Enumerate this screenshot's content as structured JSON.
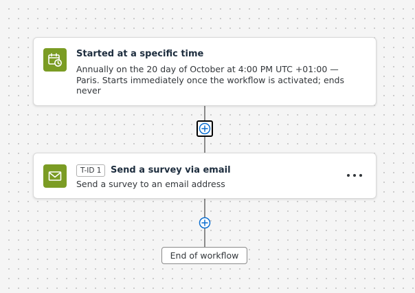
{
  "colors": {
    "accent": "#0a6ed1",
    "icon_tile": "#7b9c24",
    "connector": "#8a8a8a"
  },
  "workflow": {
    "trigger": {
      "icon": "calendar-clock-icon",
      "title": "Started at a specific time",
      "description": "Annually on the 20 day of October at 4:00 PM UTC +01:00 — Paris. Starts immediately once the workflow is activated; ends never"
    },
    "add_step_icon": "plus-circle-icon",
    "action": {
      "icon": "envelope-icon",
      "badge": "T-ID 1",
      "title": "Send a survey via email",
      "description": "Send a survey to an email address",
      "more_icon": "more-horizontal-icon"
    },
    "end": {
      "label": "End of workflow"
    }
  }
}
